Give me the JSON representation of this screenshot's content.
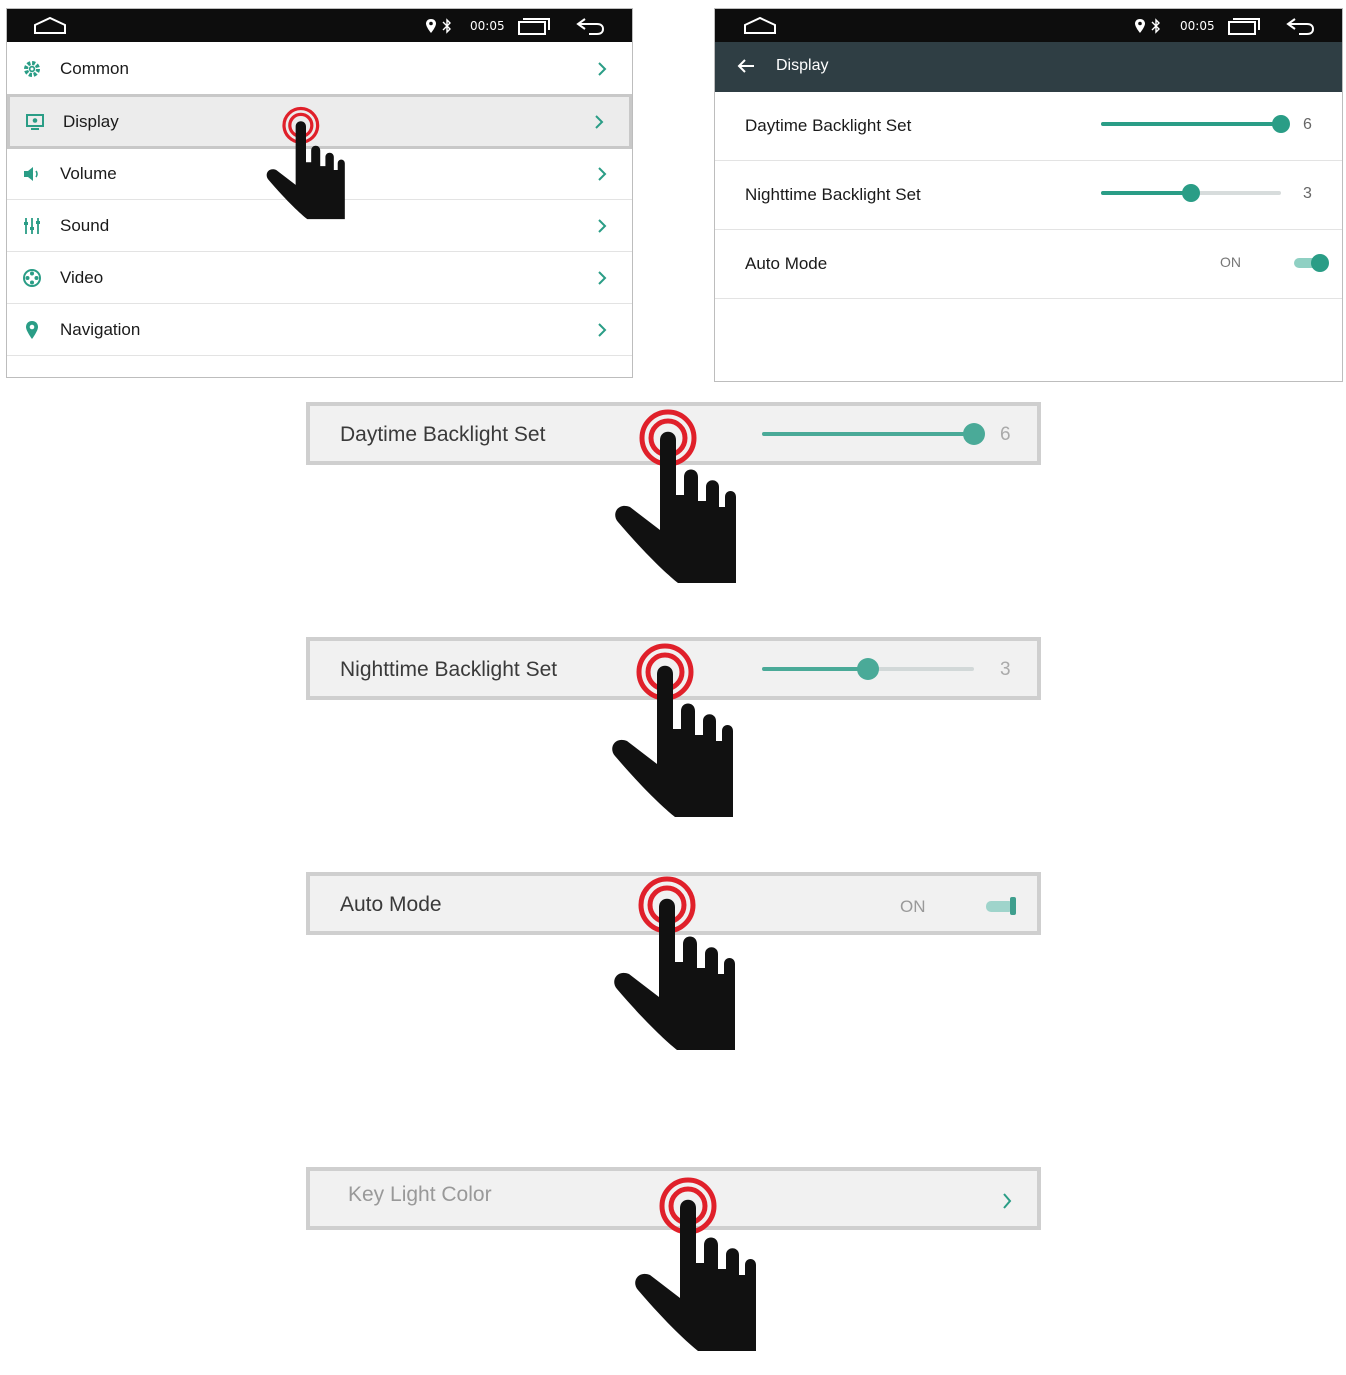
{
  "left_screen": {
    "status": {
      "time": "00:05"
    },
    "menu": [
      {
        "label": "Common",
        "icon": "gear-icon"
      },
      {
        "label": "Display",
        "icon": "display-icon",
        "selected": true
      },
      {
        "label": "Volume",
        "icon": "speaker-icon"
      },
      {
        "label": "Sound",
        "icon": "equalizer-icon"
      },
      {
        "label": "Video",
        "icon": "film-reel-icon"
      },
      {
        "label": "Navigation",
        "icon": "location-pin-icon"
      }
    ]
  },
  "right_screen": {
    "status": {
      "time": "00:05"
    },
    "header": {
      "title": "Display"
    },
    "rows": {
      "daytime": {
        "label": "Daytime Backlight Set",
        "value": "6",
        "level": 1.0
      },
      "nighttime": {
        "label": "Nighttime Backlight Set",
        "value": "3",
        "level": 0.5
      },
      "auto": {
        "label": "Auto Mode",
        "state": "ON",
        "on": true
      }
    }
  },
  "zoom_bars": {
    "daytime": {
      "label": "Daytime Backlight Set",
      "value": "6",
      "level": 1.0
    },
    "nighttime": {
      "label": "Nighttime Backlight Set",
      "value": "3",
      "level": 0.5
    },
    "auto": {
      "label": "Auto Mode",
      "state": "ON"
    },
    "key_light": {
      "label": "Key Light Color"
    }
  },
  "colors": {
    "accent": "#2a9d86",
    "status_bar": "#0d0d0d",
    "header": "#2f3e44",
    "tap_ring": "#e0202a"
  }
}
